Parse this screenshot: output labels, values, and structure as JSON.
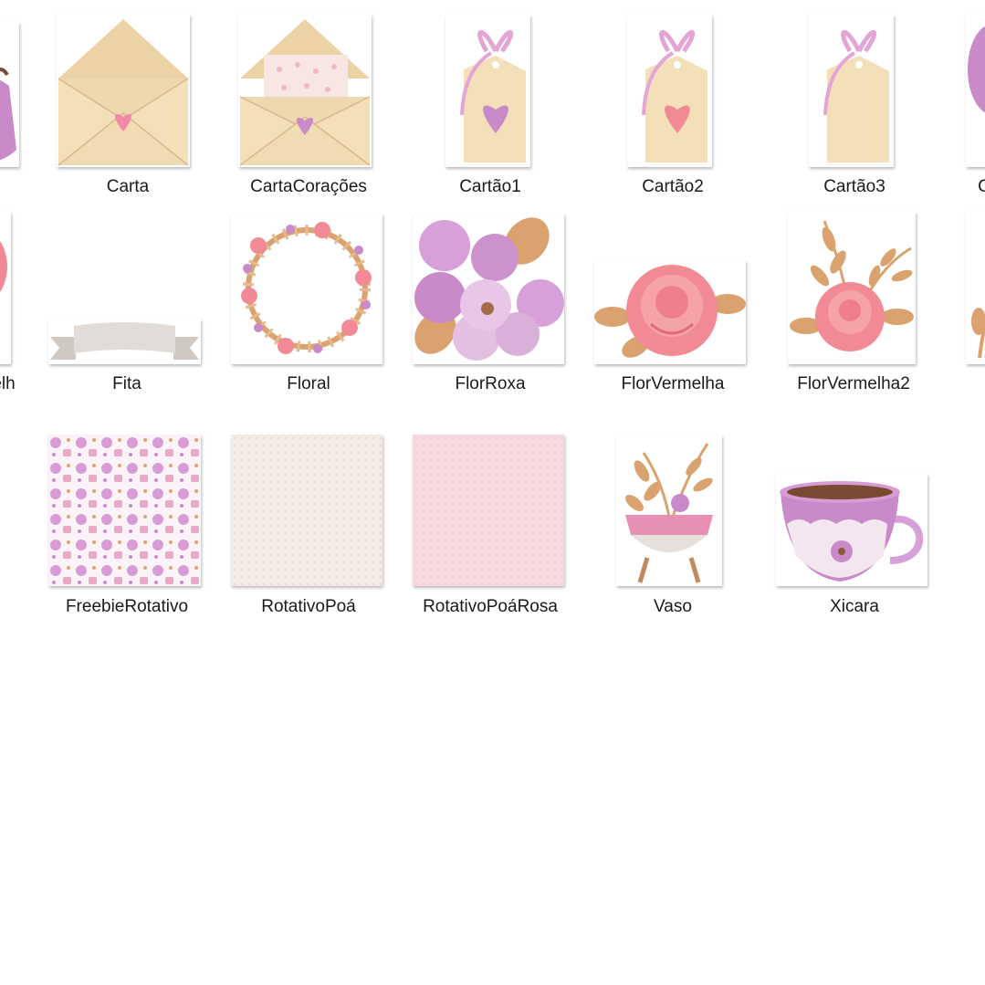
{
  "files": {
    "partial_left_1": "elh",
    "partial_right_1": "C",
    "carta": "Carta",
    "carta_coracoes": "CartaCorações",
    "cartao1": "Cartão1",
    "cartao2": "Cartão2",
    "cartao3": "Cartão3",
    "fita": "Fita",
    "floral": "Floral",
    "flor_roxa": "FlorRoxa",
    "flor_vermelha": "FlorVermelha",
    "flor_vermelha2": "FlorVermelha2",
    "freebie_rotativo": "FreebieRotativo",
    "rotativo_poa": "RotativoPoá",
    "rotativo_poa_rosa": "RotativoPoáRosa",
    "vaso": "Vaso",
    "xicara": "Xicara"
  },
  "colors": {
    "paper": "#f3dfb8",
    "pink": "#e790b4",
    "purple": "#c98ac9",
    "rose": "#f18a94",
    "leaf": "#d9a26f",
    "ribbon_gray": "#e2dcd8"
  }
}
